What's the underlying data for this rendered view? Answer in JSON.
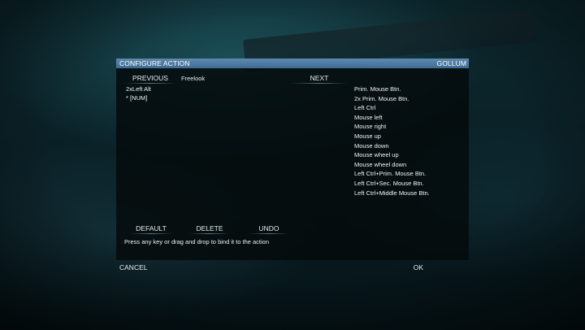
{
  "dialog": {
    "title": "CONFIGURE ACTION",
    "character": "GOLLUM"
  },
  "nav": {
    "previous_label": "PREVIOUS",
    "next_label": "NEXT",
    "action_name": "Freelook"
  },
  "bindings": [
    "2xLeft Alt",
    "* [NUM]"
  ],
  "key_options": [
    "Prim. Mouse Btn.",
    "2x Prim. Mouse Btn.",
    "Left Ctrl",
    "Mouse left",
    "Mouse right",
    "Mouse up",
    "Mouse down",
    "Mouse wheel up",
    "Mouse wheel down",
    "Left Ctrl+Prim. Mouse Btn.",
    "Left Ctrl+Sec. Mouse Btn.",
    "Left Ctrl+Middle Mouse Btn."
  ],
  "actions": {
    "default_label": "DEFAULT",
    "delete_label": "DELETE",
    "undo_label": "UNDO"
  },
  "hint": "Press any key or drag and drop to bind it to the action",
  "footer": {
    "cancel_label": "CANCEL",
    "ok_label": "OK"
  },
  "colors": {
    "titlebar": "#4f7aa2",
    "panel": "#05090b"
  }
}
